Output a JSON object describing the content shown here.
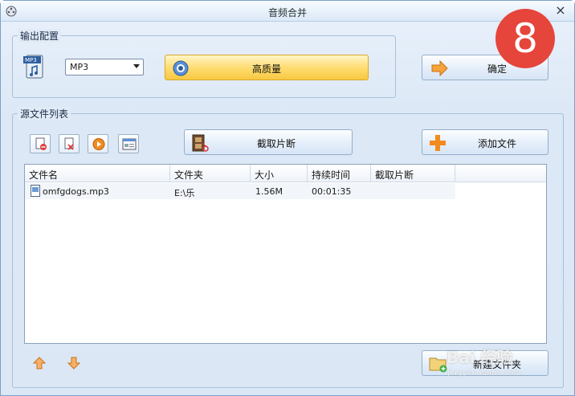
{
  "window": {
    "title": "音频合并",
    "close_glyph": "×"
  },
  "badge": {
    "text": "8"
  },
  "output_group": {
    "title": "输出配置",
    "format_select": "MP3",
    "quality_button": "高质量",
    "confirm_button": "确定"
  },
  "source_group": {
    "title": "源文件列表",
    "cut_button": "截取片断",
    "add_button": "添加文件",
    "new_folder_button": "新建文件夹"
  },
  "table": {
    "columns": [
      "文件名",
      "文件夹",
      "大小",
      "持续时间",
      "截取片断"
    ],
    "rows": [
      {
        "name": "omfgdogs.mp3",
        "folder": "E:\\乐",
        "size": "1.56M",
        "duration": "00:01:35",
        "cut": ""
      }
    ]
  },
  "watermark": {
    "main": "Bai 经验",
    "sub": "jingyan.baidu.com"
  },
  "colors": {
    "accent": "#f7c941",
    "badge": "#e5453b",
    "frame": "#7aa0c8"
  }
}
